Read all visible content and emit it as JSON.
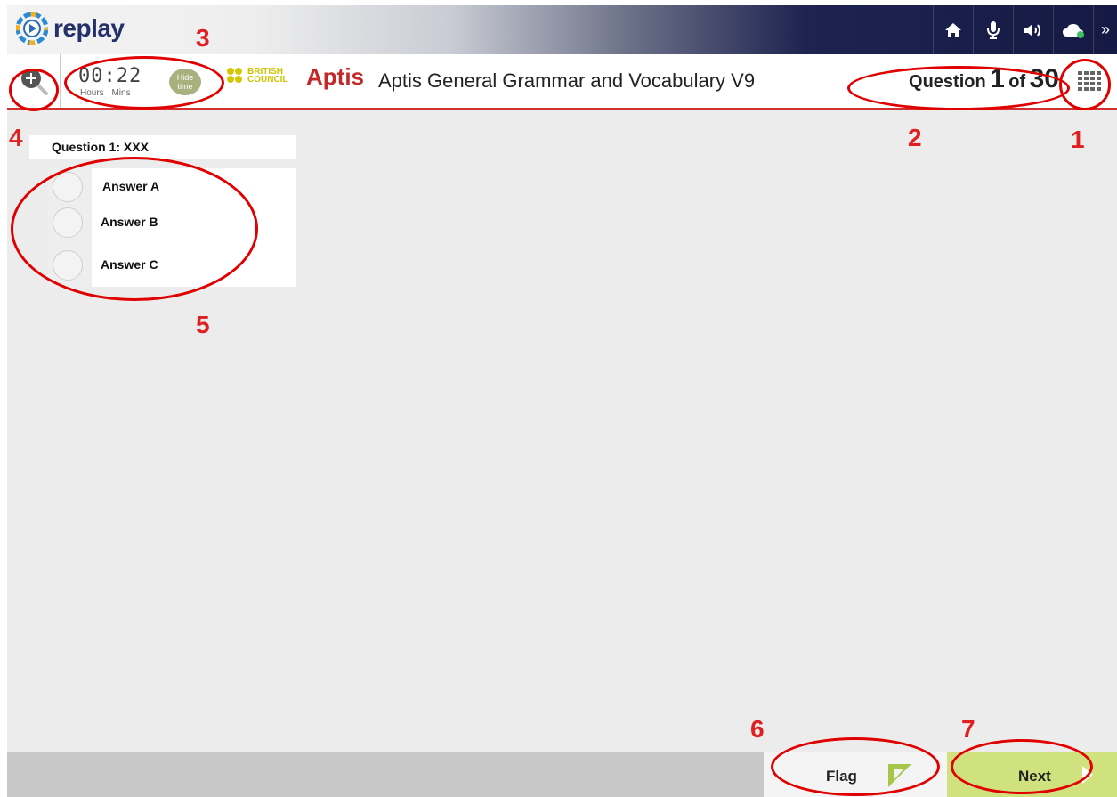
{
  "app": {
    "name": "replay"
  },
  "topbar": {
    "icons": [
      "home-icon",
      "microphone-icon",
      "speaker-icon",
      "cloud-icon",
      "double-chevron-right-icon"
    ],
    "accent": "#151a44"
  },
  "header": {
    "timer_value": "00:22",
    "timer_hours_label": "Hours",
    "timer_mins_label": "Mins",
    "hide_time_label": "Hide time",
    "bc_logo_text_1": "BRITISH",
    "bc_logo_text_2": "COUNCIL",
    "aptis_brand": "Aptis",
    "test_title": "Aptis General Grammar and Vocabulary V9",
    "question_word": "Question",
    "question_current": "1",
    "question_of": "of",
    "question_total": "30"
  },
  "question": {
    "title": "Question 1: XXX",
    "answers": [
      {
        "label": "Answer A"
      },
      {
        "label": "Answer B"
      },
      {
        "label": "Answer C"
      }
    ]
  },
  "footer": {
    "flag_label": "Flag",
    "next_label": "Next"
  },
  "annotations": [
    "1",
    "2",
    "3",
    "4",
    "5",
    "6",
    "7"
  ],
  "colors": {
    "header_rule": "#d03030",
    "aptis_red": "#c22a2a",
    "next_green": "#cfe27e",
    "annotation_red": "#e00000"
  }
}
